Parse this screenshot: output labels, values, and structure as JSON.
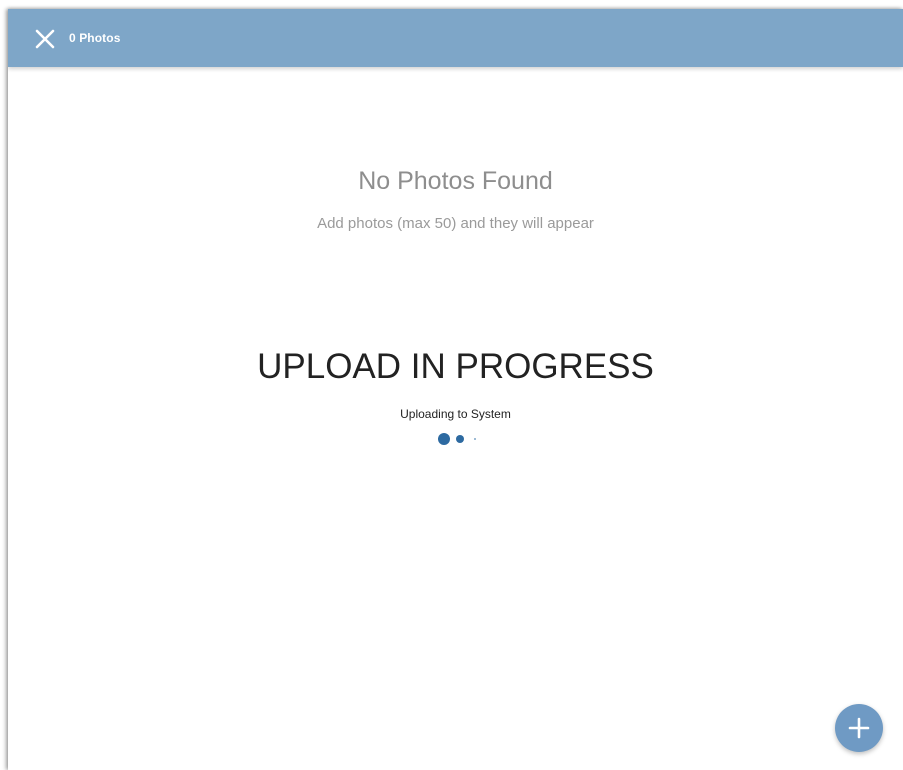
{
  "header": {
    "title": "0 Photos",
    "close_icon": "close-icon"
  },
  "empty_state": {
    "title": "No Photos Found",
    "subtitle": "Add photos (max 50) and they will appear"
  },
  "upload": {
    "title": "UPLOAD IN PROGRESS",
    "status": "Uploading to System"
  },
  "fab": {
    "icon": "plus-icon"
  },
  "colors": {
    "header_bg": "#7ea6c8",
    "accent": "#2d6aa1",
    "fab_bg": "#6f9ac4"
  }
}
